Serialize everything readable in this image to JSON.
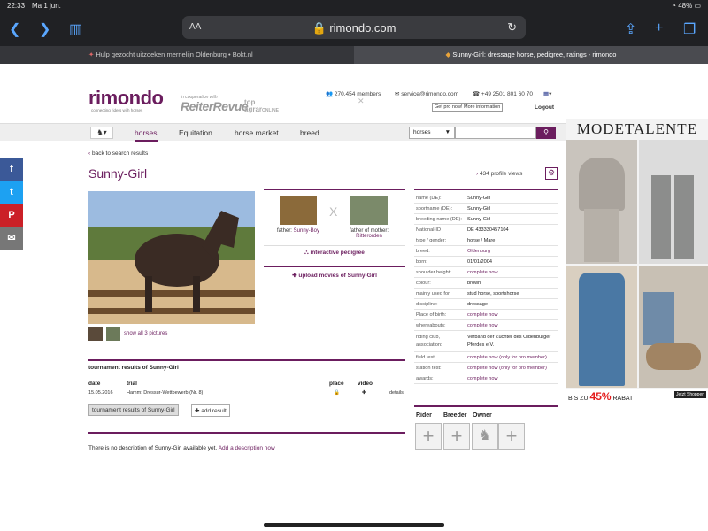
{
  "status": {
    "time": "22:33",
    "date": "Ma 1 jun.",
    "battery": "48%"
  },
  "browser": {
    "url": "rimondo.com",
    "aa": "AA"
  },
  "tabs": [
    {
      "label": "Hulp gezocht uitzoeken merrielijn Oldenburg • Bokt.nl"
    },
    {
      "label": "Sunny-Girl: dressage horse, pedigree, ratings - rimondo"
    }
  ],
  "header": {
    "logo": "rimondo",
    "logo_tagline": "connecting riders with horses",
    "coop": "in cooperation with",
    "partner1": "ReiterRevue",
    "partner2a": "top",
    "partner2b": "agrar",
    "partner2c": "ONLINE",
    "members": "270.454 members",
    "email": "service@rimondo.com",
    "phone": "+49 2501 801 60 70",
    "lang": "▾",
    "get_pro": "Get pro now! More information",
    "logout": "Logout"
  },
  "menu": {
    "horses": "horses",
    "equitation": "Equitation",
    "market": "horse market",
    "breed": "breed",
    "search_select": "horses"
  },
  "ad": {
    "title": "MODETALENTE",
    "prefix": "BIS ZU",
    "percent": "45%",
    "suffix": "RABATT",
    "button": "Jetzt Shoppen",
    "colors": {
      "pct": "#e41c1c"
    }
  },
  "page": {
    "back": "back to search results",
    "name": "Sunny-Girl",
    "views": "434 profile views",
    "show_all": "show all 3 pictures"
  },
  "parents": {
    "father_label": "father:",
    "father": "Sunny-Boy",
    "cross": "X",
    "mother_father_label": "father of mother:",
    "mother_father": "Ritterorden",
    "interactive": "interactive pedigree",
    "upload": "upload movies of Sunny-Girl"
  },
  "info": [
    {
      "label": "name (DE):",
      "value": "Sunny-Girl",
      "link": false
    },
    {
      "label": "sportname (DE):",
      "value": "Sunny-Girl",
      "link": false
    },
    {
      "label": "breeding name (DE):",
      "value": "Sunny-Girl",
      "link": false
    },
    {
      "label": "National-ID",
      "value": "DE 433330457104",
      "link": false
    },
    {
      "label": "type / gender:",
      "value": "horse / Mare",
      "link": false
    },
    {
      "label": "breed:",
      "value": "Oldenburg",
      "link": true
    },
    {
      "label": "born:",
      "value": "01/01/2004",
      "link": false
    },
    {
      "label": "shoulder height:",
      "value": "complete now",
      "link": true
    },
    {
      "label": "colour:",
      "value": "brown",
      "link": false
    },
    {
      "label": "mainly used for",
      "value": "stud horse, sportshorse",
      "link": false
    },
    {
      "label": "discipline:",
      "value": "dressage",
      "link": false
    },
    {
      "label": "Place of birth:",
      "value": "complete now",
      "link": true
    },
    {
      "label": "whereabouts:",
      "value": "complete now",
      "link": true
    },
    {
      "label": "riding club, association:",
      "value": "Verband der Züchter des Oldenburger Pferdes e.V.",
      "link": false
    },
    {
      "label": "field test:",
      "value": "complete now (only for pro member)",
      "link": true
    },
    {
      "label": "station test:",
      "value": "complete now (only for pro member)",
      "link": true
    },
    {
      "label": "awards:",
      "value": "complete now",
      "link": true
    }
  ],
  "tournaments": {
    "title": "tournament results of Sunny-Girl",
    "headers": {
      "date": "date",
      "trial": "trial",
      "place": "place",
      "video": "video"
    },
    "rows": [
      {
        "date": "15.05.2016",
        "trial": "Hamm: Dressur-Wettbewerb (Nr. 8)",
        "details": "details"
      }
    ],
    "button": "tournament results of Sunny-Girl",
    "add": "add result"
  },
  "description": {
    "text": "There is no description of Sunny-Girl available yet.",
    "link": "Add a description now"
  },
  "people": {
    "rider": "Rider",
    "breeder": "Breeder",
    "owner": "Owner"
  },
  "colors": {
    "brand": "#6b1d5e"
  }
}
